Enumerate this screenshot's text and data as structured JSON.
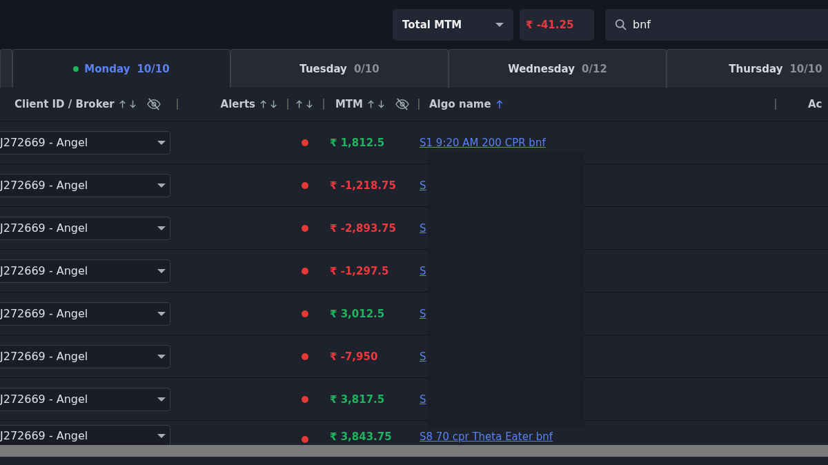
{
  "toolbar": {
    "metric_select": {
      "value": "Total MTM"
    },
    "total": {
      "value": "₹ -41.25",
      "profit": false
    },
    "search": {
      "value": "bnf"
    }
  },
  "tabs": [
    {
      "label": "Monday",
      "count": "10/10",
      "selected": true,
      "active_dot": true
    },
    {
      "label": "Tuesday",
      "count": "0/10",
      "selected": false,
      "active_dot": false
    },
    {
      "label": "Wednesday",
      "count": "0/12",
      "selected": false,
      "active_dot": false
    },
    {
      "label": "Thursday",
      "count": "10/10",
      "selected": false,
      "active_dot": false
    }
  ],
  "table": {
    "columns": [
      {
        "label": "Client ID / Broker",
        "sortable": true,
        "sorted": false,
        "hide": true
      },
      {
        "label": "Alerts",
        "sortable": true,
        "sorted": false,
        "hide": false
      },
      {
        "sortable": true,
        "sorted": false,
        "hide": false
      },
      {
        "label": "MTM",
        "sortable": true,
        "sorted": false,
        "hide": true
      },
      {
        "label": "Algo name",
        "sortable": true,
        "sorted": true,
        "hide": false
      },
      {
        "label": "Ac",
        "sortable": false,
        "hide": false
      }
    ],
    "rows": [
      {
        "client": "J272669 - Angel",
        "color": "#e53935",
        "mtm": "₹ 1,812.5",
        "profit": true,
        "algo": "S1 9:20 AM 200 CPR bnf"
      },
      {
        "client": "J272669 - Angel",
        "color": "#e53935",
        "mtm": "₹ -1,218.75",
        "profit": false,
        "algo": "S"
      },
      {
        "client": "J272669 - Angel",
        "color": "#e53935",
        "mtm": "₹ -2,893.75",
        "profit": false,
        "algo": "S"
      },
      {
        "client": "J272669 - Angel",
        "color": "#e53935",
        "mtm": "₹ -1,297.5",
        "profit": false,
        "algo": "S"
      },
      {
        "client": "J272669 - Angel",
        "color": "#e53935",
        "mtm": "₹ 3,012.5",
        "profit": true,
        "algo": "S"
      },
      {
        "client": "J272669 - Angel",
        "color": "#e53935",
        "mtm": "₹ -7,950",
        "profit": false,
        "algo": "S"
      },
      {
        "client": "J272669 - Angel",
        "color": "#e53935",
        "mtm": "₹ 3,817.5",
        "profit": true,
        "algo": "S"
      },
      {
        "client": "J272669 - Angel",
        "color": "#e53935",
        "mtm": "₹ 3,843.75",
        "profit": true,
        "algo": "S8 70 cpr Theta Eater bnf"
      }
    ]
  }
}
